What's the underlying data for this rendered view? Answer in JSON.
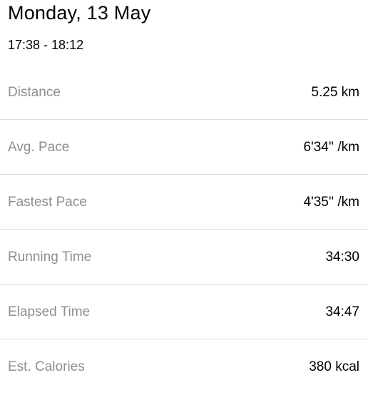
{
  "header": {
    "title": "Monday, 13 May",
    "time_range": "17:38 - 18:12"
  },
  "stats": [
    {
      "label": "Distance",
      "value": "5.25 km"
    },
    {
      "label": "Avg. Pace",
      "value": "6'34'' /km"
    },
    {
      "label": "Fastest Pace",
      "value": "4'35'' /km"
    },
    {
      "label": "Running Time",
      "value": "34:30"
    },
    {
      "label": "Elapsed Time",
      "value": "34:47"
    },
    {
      "label": "Est. Calories",
      "value": "380 kcal"
    }
  ],
  "colors": {
    "label": "#8e8e93",
    "value": "#000000",
    "divider": "#dcdcdc",
    "background": "#ffffff"
  }
}
